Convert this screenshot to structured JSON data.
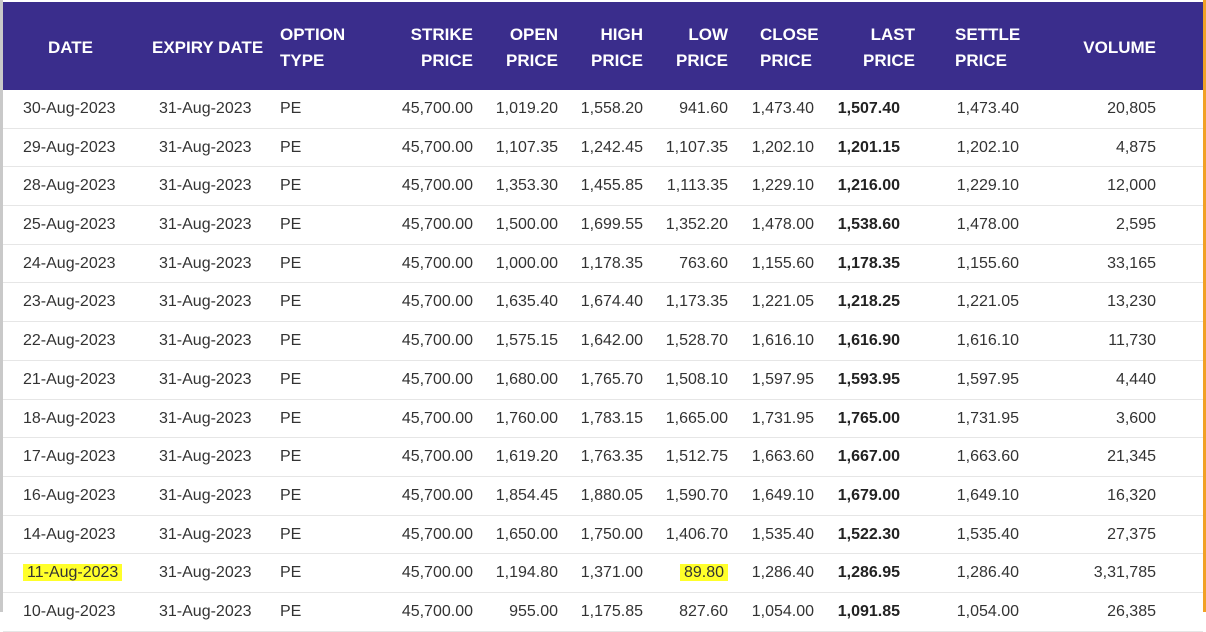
{
  "columns": [
    "DATE",
    [
      "EXPIRY DATE"
    ],
    [
      "OPTION",
      "TYPE"
    ],
    [
      "STRIKE",
      "PRICE"
    ],
    [
      "OPEN",
      "PRICE"
    ],
    [
      "HIGH",
      "PRICE"
    ],
    [
      "LOW",
      "PRICE"
    ],
    [
      "CLOSE",
      "PRICE"
    ],
    [
      "LAST",
      "PRICE"
    ],
    [
      "SETTLE",
      "PRICE"
    ],
    "VOLUME"
  ],
  "header": {
    "date": "DATE",
    "expiry": "EXPIRY DATE",
    "option_1": "OPTION",
    "option_2": "TYPE",
    "strike_1": "STRIKE",
    "strike_2": "PRICE",
    "open_1": "OPEN",
    "open_2": "PRICE",
    "high_1": "HIGH",
    "high_2": "PRICE",
    "low_1": "LOW",
    "low_2": "PRICE",
    "close_1": "CLOSE",
    "close_2": "PRICE",
    "last_1": "LAST",
    "last_2": "PRICE",
    "settle_1": "SETTLE",
    "settle_2": "PRICE",
    "volume": "VOLUME"
  },
  "rows": [
    {
      "date": "30-Aug-2023",
      "expiry": "31-Aug-2023",
      "type": "PE",
      "strike": "45,700.00",
      "open": "1,019.20",
      "high": "1,558.20",
      "low": "941.60",
      "close": "1,473.40",
      "last": "1,507.40",
      "settle": "1,473.40",
      "volume": "20,805"
    },
    {
      "date": "29-Aug-2023",
      "expiry": "31-Aug-2023",
      "type": "PE",
      "strike": "45,700.00",
      "open": "1,107.35",
      "high": "1,242.45",
      "low": "1,107.35",
      "close": "1,202.10",
      "last": "1,201.15",
      "settle": "1,202.10",
      "volume": "4,875"
    },
    {
      "date": "28-Aug-2023",
      "expiry": "31-Aug-2023",
      "type": "PE",
      "strike": "45,700.00",
      "open": "1,353.30",
      "high": "1,455.85",
      "low": "1,113.35",
      "close": "1,229.10",
      "last": "1,216.00",
      "settle": "1,229.10",
      "volume": "12,000"
    },
    {
      "date": "25-Aug-2023",
      "expiry": "31-Aug-2023",
      "type": "PE",
      "strike": "45,700.00",
      "open": "1,500.00",
      "high": "1,699.55",
      "low": "1,352.20",
      "close": "1,478.00",
      "last": "1,538.60",
      "settle": "1,478.00",
      "volume": "2,595"
    },
    {
      "date": "24-Aug-2023",
      "expiry": "31-Aug-2023",
      "type": "PE",
      "strike": "45,700.00",
      "open": "1,000.00",
      "high": "1,178.35",
      "low": "763.60",
      "close": "1,155.60",
      "last": "1,178.35",
      "settle": "1,155.60",
      "volume": "33,165"
    },
    {
      "date": "23-Aug-2023",
      "expiry": "31-Aug-2023",
      "type": "PE",
      "strike": "45,700.00",
      "open": "1,635.40",
      "high": "1,674.40",
      "low": "1,173.35",
      "close": "1,221.05",
      "last": "1,218.25",
      "settle": "1,221.05",
      "volume": "13,230"
    },
    {
      "date": "22-Aug-2023",
      "expiry": "31-Aug-2023",
      "type": "PE",
      "strike": "45,700.00",
      "open": "1,575.15",
      "high": "1,642.00",
      "low": "1,528.70",
      "close": "1,616.10",
      "last": "1,616.90",
      "settle": "1,616.10",
      "volume": "11,730"
    },
    {
      "date": "21-Aug-2023",
      "expiry": "31-Aug-2023",
      "type": "PE",
      "strike": "45,700.00",
      "open": "1,680.00",
      "high": "1,765.70",
      "low": "1,508.10",
      "close": "1,597.95",
      "last": "1,593.95",
      "settle": "1,597.95",
      "volume": "4,440"
    },
    {
      "date": "18-Aug-2023",
      "expiry": "31-Aug-2023",
      "type": "PE",
      "strike": "45,700.00",
      "open": "1,760.00",
      "high": "1,783.15",
      "low": "1,665.00",
      "close": "1,731.95",
      "last": "1,765.00",
      "settle": "1,731.95",
      "volume": "3,600"
    },
    {
      "date": "17-Aug-2023",
      "expiry": "31-Aug-2023",
      "type": "PE",
      "strike": "45,700.00",
      "open": "1,619.20",
      "high": "1,763.35",
      "low": "1,512.75",
      "close": "1,663.60",
      "last": "1,667.00",
      "settle": "1,663.60",
      "volume": "21,345"
    },
    {
      "date": "16-Aug-2023",
      "expiry": "31-Aug-2023",
      "type": "PE",
      "strike": "45,700.00",
      "open": "1,854.45",
      "high": "1,880.05",
      "low": "1,590.70",
      "close": "1,649.10",
      "last": "1,679.00",
      "settle": "1,649.10",
      "volume": "16,320"
    },
    {
      "date": "14-Aug-2023",
      "expiry": "31-Aug-2023",
      "type": "PE",
      "strike": "45,700.00",
      "open": "1,650.00",
      "high": "1,750.00",
      "low": "1,406.70",
      "close": "1,535.40",
      "last": "1,522.30",
      "settle": "1,535.40",
      "volume": "27,375"
    },
    {
      "date": "11-Aug-2023",
      "expiry": "31-Aug-2023",
      "type": "PE",
      "strike": "45,700.00",
      "open": "1,194.80",
      "high": "1,371.00",
      "low": "89.80",
      "close": "1,286.40",
      "last": "1,286.95",
      "settle": "1,286.40",
      "volume": "3,31,785",
      "highlight_date": true,
      "highlight_low": true
    },
    {
      "date": "10-Aug-2023",
      "expiry": "31-Aug-2023",
      "type": "PE",
      "strike": "45,700.00",
      "open": "955.00",
      "high": "1,175.85",
      "low": "827.60",
      "close": "1,054.00",
      "last": "1,091.85",
      "settle": "1,054.00",
      "volume": "26,385"
    }
  ],
  "colors": {
    "header_bg": "#3a2d8c",
    "highlight": "#ffff2a",
    "accent_rule": "#f1a126"
  }
}
